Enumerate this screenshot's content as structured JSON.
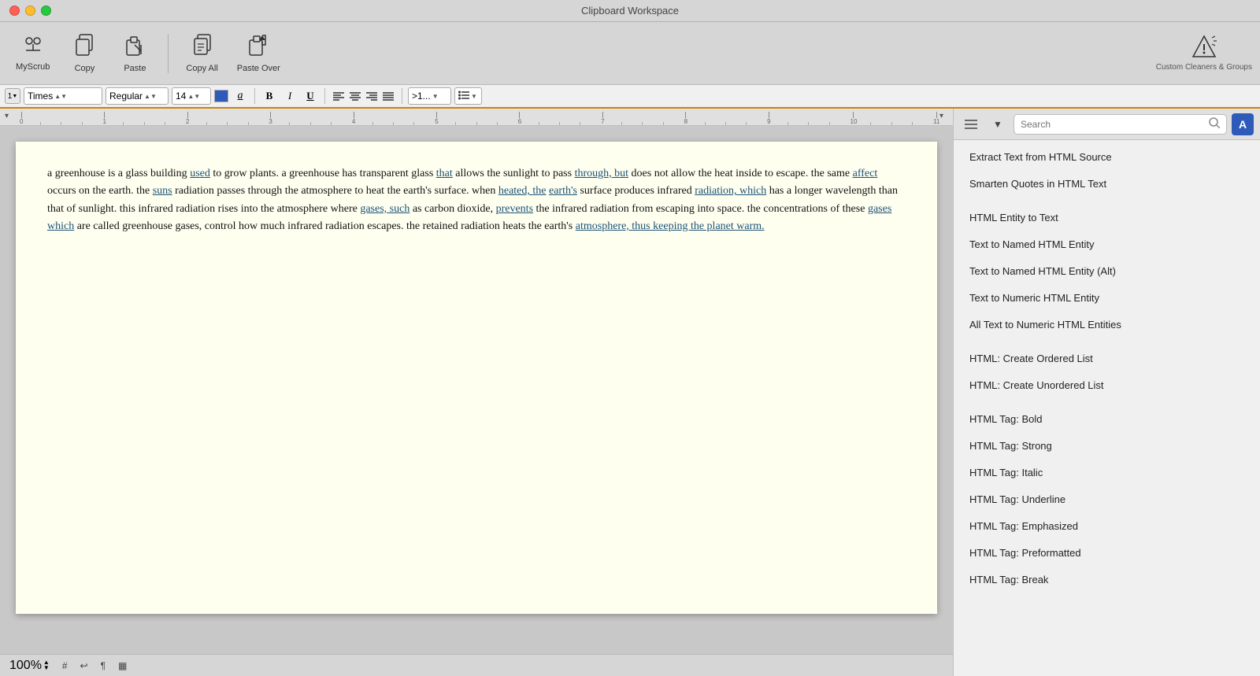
{
  "titleBar": {
    "title": "Clipboard Workspace"
  },
  "toolbar": {
    "buttons": [
      {
        "id": "myscrub",
        "icon": "✦",
        "label": "MyScrub",
        "unicode": "⟡"
      },
      {
        "id": "copy",
        "icon": "📋",
        "label": "Copy"
      },
      {
        "id": "paste",
        "icon": "🖊",
        "label": "Paste"
      },
      {
        "id": "copyall",
        "icon": "📋",
        "label": "Copy All"
      },
      {
        "id": "pasteover",
        "icon": "📌",
        "label": "Paste Over"
      }
    ],
    "rightLabel": "Custom Cleaners & Groups"
  },
  "formatBar": {
    "listNum": "1",
    "font": "Times",
    "style": "Regular",
    "size": "14",
    "colorHex": "#2e5bba",
    "charA": "a",
    "boldLabel": "B",
    "italicLabel": "I",
    "underlineLabel": "U",
    "alignLeft": "≡",
    "alignCenter": "≡",
    "alignRight": "≡",
    "alignJustify": "≡",
    "moreLabel": ">1...",
    "listLabel": "☰"
  },
  "ruler": {
    "ticks": [
      "0",
      "1",
      "2",
      "3",
      "4",
      "5",
      "6",
      "7",
      "8",
      "9",
      "10",
      "11"
    ]
  },
  "document": {
    "content": [
      {
        "type": "paragraph",
        "segments": [
          {
            "text": "a greenhouse is a glass building ",
            "style": "normal"
          },
          {
            "text": "used",
            "style": "link"
          },
          {
            "text": " to grow plants. a greenhouse has transparent glass ",
            "style": "normal"
          },
          {
            "text": "that",
            "style": "link"
          },
          {
            "text": " allows the sunlight to pass ",
            "style": "normal"
          },
          {
            "text": "through, but",
            "style": "link"
          },
          {
            "text": " does not allow the heat inside to escape. the same ",
            "style": "normal"
          },
          {
            "text": "affect",
            "style": "link"
          },
          {
            "text": " occurs on the earth. the ",
            "style": "normal"
          },
          {
            "text": "suns",
            "style": "link"
          },
          {
            "text": " radiation passes through the atmosphere to heat the earth's surface. when ",
            "style": "normal"
          },
          {
            "text": "heated, the",
            "style": "link"
          },
          {
            "text": " ",
            "style": "normal"
          },
          {
            "text": "earth's",
            "style": "link"
          },
          {
            "text": " surface produces infrared ",
            "style": "normal"
          },
          {
            "text": "radiation, which",
            "style": "link"
          },
          {
            "text": " has a longer wavelength than that of sunlight. this infrared radiation rises into the atmosphere where ",
            "style": "normal"
          },
          {
            "text": "gases, such",
            "style": "link"
          },
          {
            "text": " as carbon dioxide, ",
            "style": "normal"
          },
          {
            "text": "prevents",
            "style": "link"
          },
          {
            "text": " the infrared radiation from escaping into space. the concentrations of these ",
            "style": "normal"
          },
          {
            "text": "gases which",
            "style": "link"
          },
          {
            "text": " are called greenhouse gases, control how much infrared radiation escapes. the retained radiation heats the earth's ",
            "style": "normal"
          },
          {
            "text": "atmosphere, thus keeping the planet warm.",
            "style": "link"
          }
        ]
      }
    ]
  },
  "statusBar": {
    "zoom": "100%",
    "hashLabel": "#",
    "returnLabel": "↩",
    "paragraphLabel": "¶",
    "chartLabel": "▦"
  },
  "rightPanel": {
    "search": {
      "placeholder": "Search",
      "value": ""
    },
    "items": [
      {
        "id": "extract-text-html",
        "label": "Extract Text from HTML Source",
        "group": 1
      },
      {
        "id": "smarten-quotes",
        "label": "Smarten Quotes in HTML Text",
        "group": 1
      },
      {
        "id": "html-entity-to-text",
        "label": "HTML Entity to Text",
        "group": 2
      },
      {
        "id": "text-to-named-html",
        "label": "Text to Named HTML Entity",
        "group": 2
      },
      {
        "id": "text-to-named-html-alt",
        "label": "Text to Named HTML Entity (Alt)",
        "group": 2
      },
      {
        "id": "text-to-numeric-html",
        "label": "Text to Numeric HTML Entity",
        "group": 2
      },
      {
        "id": "all-text-to-numeric",
        "label": "All Text to Numeric HTML Entities",
        "group": 2
      },
      {
        "id": "html-ordered-list",
        "label": "HTML: Create Ordered List",
        "group": 3
      },
      {
        "id": "html-unordered-list",
        "label": "HTML: Create Unordered List",
        "group": 3
      },
      {
        "id": "html-tag-bold",
        "label": "HTML Tag: Bold",
        "group": 4
      },
      {
        "id": "html-tag-strong",
        "label": "HTML Tag: Strong",
        "group": 4
      },
      {
        "id": "html-tag-italic",
        "label": "HTML Tag: Italic",
        "group": 4
      },
      {
        "id": "html-tag-underline",
        "label": "HTML Tag: Underline",
        "group": 4
      },
      {
        "id": "html-tag-emphasized",
        "label": "HTML Tag: Emphasized",
        "group": 4
      },
      {
        "id": "html-tag-preformatted",
        "label": "HTML Tag: Preformatted",
        "group": 4
      },
      {
        "id": "html-tag-break",
        "label": "HTML Tag: Break",
        "group": 4
      }
    ]
  }
}
